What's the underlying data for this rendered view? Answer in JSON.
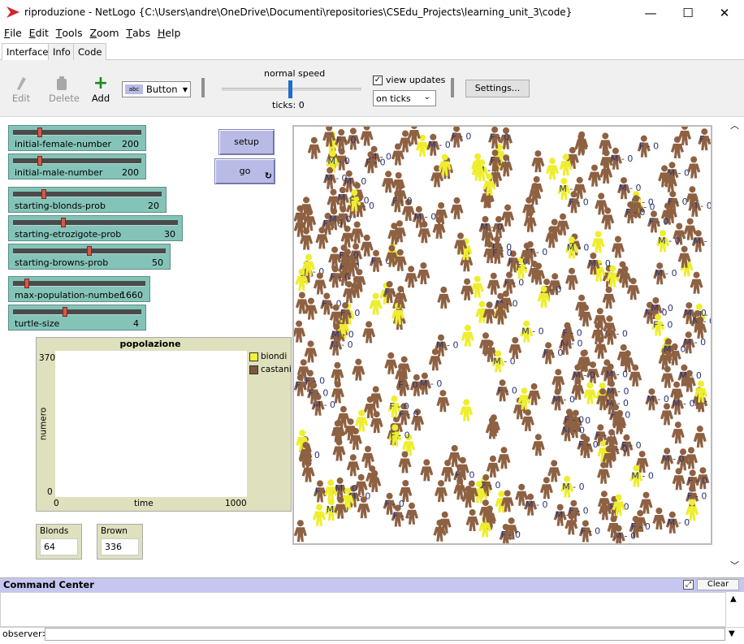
{
  "window": {
    "title": "riproduzione - NetLogo {C:\\Users\\andre\\OneDrive\\Documenti\\repositories\\CSEdu_Projects\\learning_unit_3\\code}",
    "minimize": "—",
    "maximize": "☐",
    "close": "✕"
  },
  "menu": [
    {
      "first": "F",
      "rest": "ile"
    },
    {
      "first": "E",
      "rest": "dit"
    },
    {
      "first": "T",
      "rest": "ools"
    },
    {
      "first": "Z",
      "rest": "oom"
    },
    {
      "first": "T",
      "rest": "abs"
    },
    {
      "first": "H",
      "rest": "elp"
    }
  ],
  "tabs": {
    "interface": "Interface",
    "info": "Info",
    "code": "Code",
    "active": "interface"
  },
  "toolbar": {
    "edit": "Edit",
    "delete": "Delete",
    "add": "Add",
    "widget_type": "Button",
    "speed_label": "normal speed",
    "speed_level": 0.5,
    "ticks_label": "ticks: 0",
    "view_updates_label": "view updates",
    "view_updates_checked": true,
    "update_mode": "on ticks",
    "settings": "Settings..."
  },
  "sliders": [
    {
      "name": "initial-female-number",
      "value": "200",
      "fraction": 0.2
    },
    {
      "name": "initial-male-number",
      "value": "200",
      "fraction": 0.2
    },
    {
      "name": "starting-blonds-prob",
      "value": "20",
      "fraction": 0.2
    },
    {
      "name": "starting-etrozigote-prob",
      "value": "30",
      "fraction": 0.3
    },
    {
      "name": "starting-browns-prob",
      "value": "50",
      "fraction": 0.5
    },
    {
      "name": "max-population-number",
      "value": "1660",
      "fraction": 0.09
    },
    {
      "name": "turtle-size",
      "value": "4",
      "fraction": 0.4
    }
  ],
  "buttons": {
    "setup": "setup",
    "go": "go",
    "forever_icon": "↻"
  },
  "plot": {
    "title": "popolazione",
    "xlabel": "time",
    "ylabel": "numero",
    "xmin": "0",
    "xmax": "1000",
    "ymin": "0",
    "ymax": "370",
    "legend": [
      {
        "name": "biondi",
        "color": "#f2f23c"
      },
      {
        "name": "castani",
        "color": "#7a5a3c"
      }
    ]
  },
  "monitors": [
    {
      "name": "Blonds",
      "value": "64"
    },
    {
      "name": "Brown",
      "value": "336"
    }
  ],
  "view": {
    "brown_color": "#8e6142",
    "blond_color": "#eeee2e",
    "label_color": "#2a3472",
    "labels": [
      "M - 0",
      "F - 0"
    ],
    "brown_count": 336,
    "blond_count": 64
  },
  "command_center": {
    "title": "Command Center",
    "clear": "Clear",
    "prompt": "observer>"
  }
}
